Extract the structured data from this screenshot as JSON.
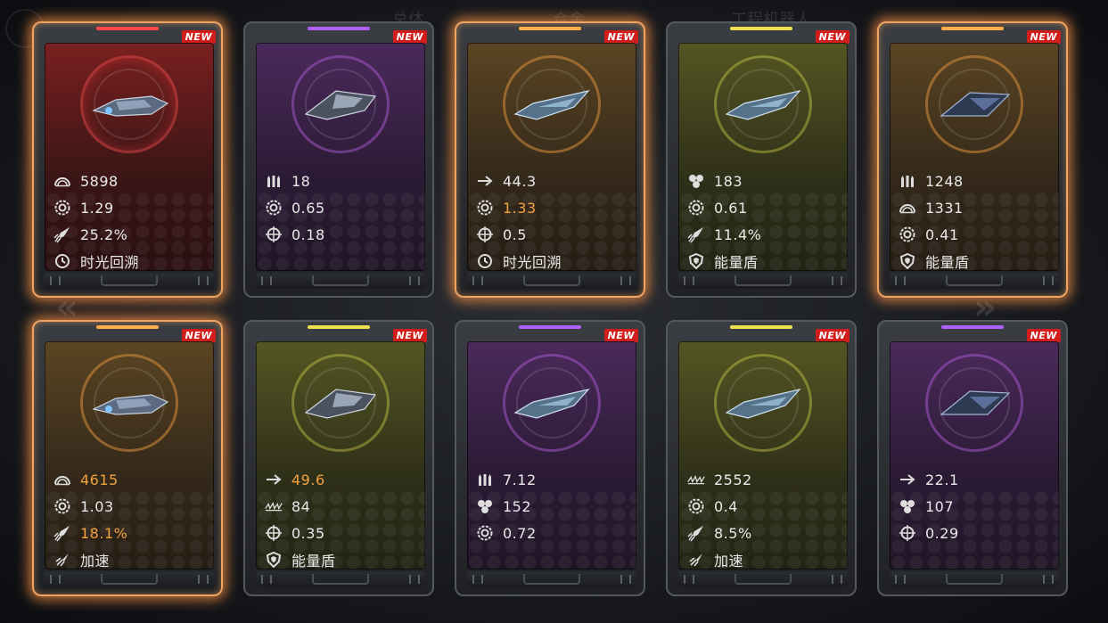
{
  "background": {
    "hints": [
      "总体",
      "合金",
      "工程机器人"
    ]
  },
  "new_label": "NEW",
  "cards": [
    {
      "theme": "red",
      "glow": true,
      "stats": [
        {
          "icon": "armor-icon",
          "value": "5898",
          "highlight": false
        },
        {
          "icon": "gear-icon",
          "value": "1.29",
          "highlight": false
        },
        {
          "icon": "missile-icon",
          "value": "25.2%",
          "highlight": false
        },
        {
          "icon": "time-rewind-icon",
          "value": "时光回溯",
          "highlight": false
        }
      ]
    },
    {
      "theme": "purple",
      "glow": false,
      "stats": [
        {
          "icon": "ammo-icon",
          "value": "18",
          "highlight": false
        },
        {
          "icon": "gear-icon",
          "value": "0.65",
          "highlight": false
        },
        {
          "icon": "crosshair-icon",
          "value": "0.18",
          "highlight": false
        }
      ]
    },
    {
      "theme": "orange",
      "glow": true,
      "stats": [
        {
          "icon": "speed-arrow-icon",
          "value": "44.3",
          "highlight": false
        },
        {
          "icon": "gear-icon",
          "value": "1.33",
          "highlight": true
        },
        {
          "icon": "crosshair-icon",
          "value": "0.5",
          "highlight": false
        },
        {
          "icon": "time-rewind-icon",
          "value": "时光回溯",
          "highlight": false
        }
      ]
    },
    {
      "theme": "olive",
      "glow": false,
      "stats": [
        {
          "icon": "cluster-icon",
          "value": "183",
          "highlight": false
        },
        {
          "icon": "gear-icon",
          "value": "0.61",
          "highlight": false
        },
        {
          "icon": "missile-icon",
          "value": "11.4%",
          "highlight": false
        },
        {
          "icon": "shield-icon",
          "value": "能量盾",
          "highlight": false
        }
      ]
    },
    {
      "theme": "orange",
      "glow": true,
      "stats": [
        {
          "icon": "ammo-icon",
          "value": "1248",
          "highlight": false
        },
        {
          "icon": "armor-icon",
          "value": "1331",
          "highlight": false
        },
        {
          "icon": "gear-icon",
          "value": "0.41",
          "highlight": false
        },
        {
          "icon": "shield-icon",
          "value": "能量盾",
          "highlight": false
        }
      ]
    },
    {
      "theme": "orange",
      "glow": true,
      "stats": [
        {
          "icon": "armor-icon",
          "value": "4615",
          "highlight": true
        },
        {
          "icon": "gear-icon",
          "value": "1.03",
          "highlight": false
        },
        {
          "icon": "missile-icon",
          "value": "18.1%",
          "highlight": true
        },
        {
          "icon": "boost-icon",
          "value": "加速",
          "highlight": false
        }
      ]
    },
    {
      "theme": "olive",
      "glow": false,
      "stats": [
        {
          "icon": "speed-arrow-icon",
          "value": "49.6",
          "highlight": true
        },
        {
          "icon": "barrage-icon",
          "value": "84",
          "highlight": false
        },
        {
          "icon": "crosshair-icon",
          "value": "0.35",
          "highlight": false
        },
        {
          "icon": "shield-icon",
          "value": "能量盾",
          "highlight": false
        }
      ]
    },
    {
      "theme": "purple",
      "glow": false,
      "stats": [
        {
          "icon": "ammo-icon",
          "value": "7.12",
          "highlight": false
        },
        {
          "icon": "cluster-icon",
          "value": "152",
          "highlight": false
        },
        {
          "icon": "gear-icon",
          "value": "0.72",
          "highlight": false
        }
      ]
    },
    {
      "theme": "olive",
      "glow": false,
      "stats": [
        {
          "icon": "barrage-icon",
          "value": "2552",
          "highlight": false
        },
        {
          "icon": "gear-icon",
          "value": "0.4",
          "highlight": false
        },
        {
          "icon": "missile-icon",
          "value": "8.5%",
          "highlight": false
        },
        {
          "icon": "boost-icon",
          "value": "加速",
          "highlight": false
        }
      ]
    },
    {
      "theme": "purple",
      "glow": false,
      "stats": [
        {
          "icon": "speed-arrow-icon",
          "value": "22.1",
          "highlight": false
        },
        {
          "icon": "cluster-icon",
          "value": "107",
          "highlight": false
        },
        {
          "icon": "crosshair-icon",
          "value": "0.29",
          "highlight": false
        }
      ]
    }
  ]
}
